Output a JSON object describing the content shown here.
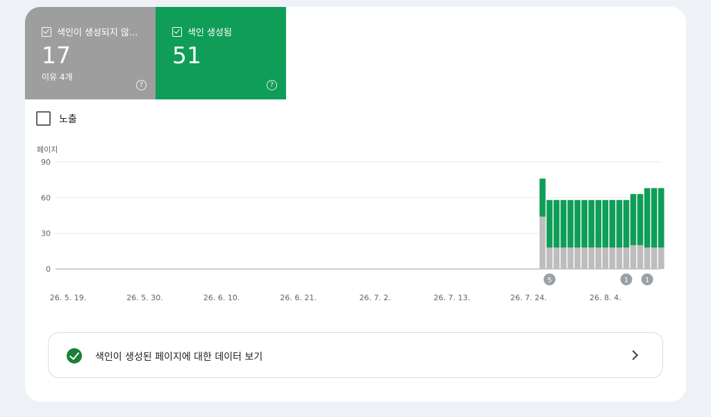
{
  "tiles": [
    {
      "label": "색인이 생성되지 않...",
      "count": "17",
      "sub": "이유 4개",
      "help": "?",
      "color": "#9e9e9e"
    },
    {
      "label": "색인 생성됨",
      "count": "51",
      "help": "?",
      "color": "#0f9d58"
    }
  ],
  "impressions": {
    "label": "노출"
  },
  "chart": {
    "y_axis_title": "페이지"
  },
  "chart_data": {
    "type": "bar",
    "stacked": true,
    "ylabel": "페이지",
    "ylim": [
      0,
      90
    ],
    "yticks": [
      "90",
      "60",
      "30",
      "0"
    ],
    "grid": true,
    "x_tick_labels": [
      "26. 5. 19.",
      "26. 5. 30.",
      "26. 6. 10.",
      "26. 6. 21.",
      "26. 7. 2.",
      "26. 7. 13.",
      "26. 7. 24.",
      "26. 8. 4."
    ],
    "bar_start_index": 68,
    "total_days": 88,
    "series": [
      {
        "name": "색인이 생성되지 않...",
        "color": "#bdbdbd",
        "values": [
          44,
          18,
          18,
          18,
          18,
          18,
          18,
          18,
          18,
          18,
          18,
          18,
          18,
          20,
          20,
          18,
          18,
          18
        ]
      },
      {
        "name": "색인 생성됨",
        "color": "#0f9d58",
        "values": [
          32,
          40,
          40,
          40,
          40,
          40,
          40,
          40,
          40,
          40,
          40,
          40,
          40,
          43,
          43,
          50,
          50,
          50
        ]
      }
    ],
    "annotations": [
      {
        "label": "5",
        "day_index": 69
      },
      {
        "label": "1",
        "day_index": 80
      },
      {
        "label": "1",
        "day_index": 83
      }
    ]
  },
  "cta": {
    "label": "색인이 생성된 페이지에 대한 데이터 보기"
  }
}
